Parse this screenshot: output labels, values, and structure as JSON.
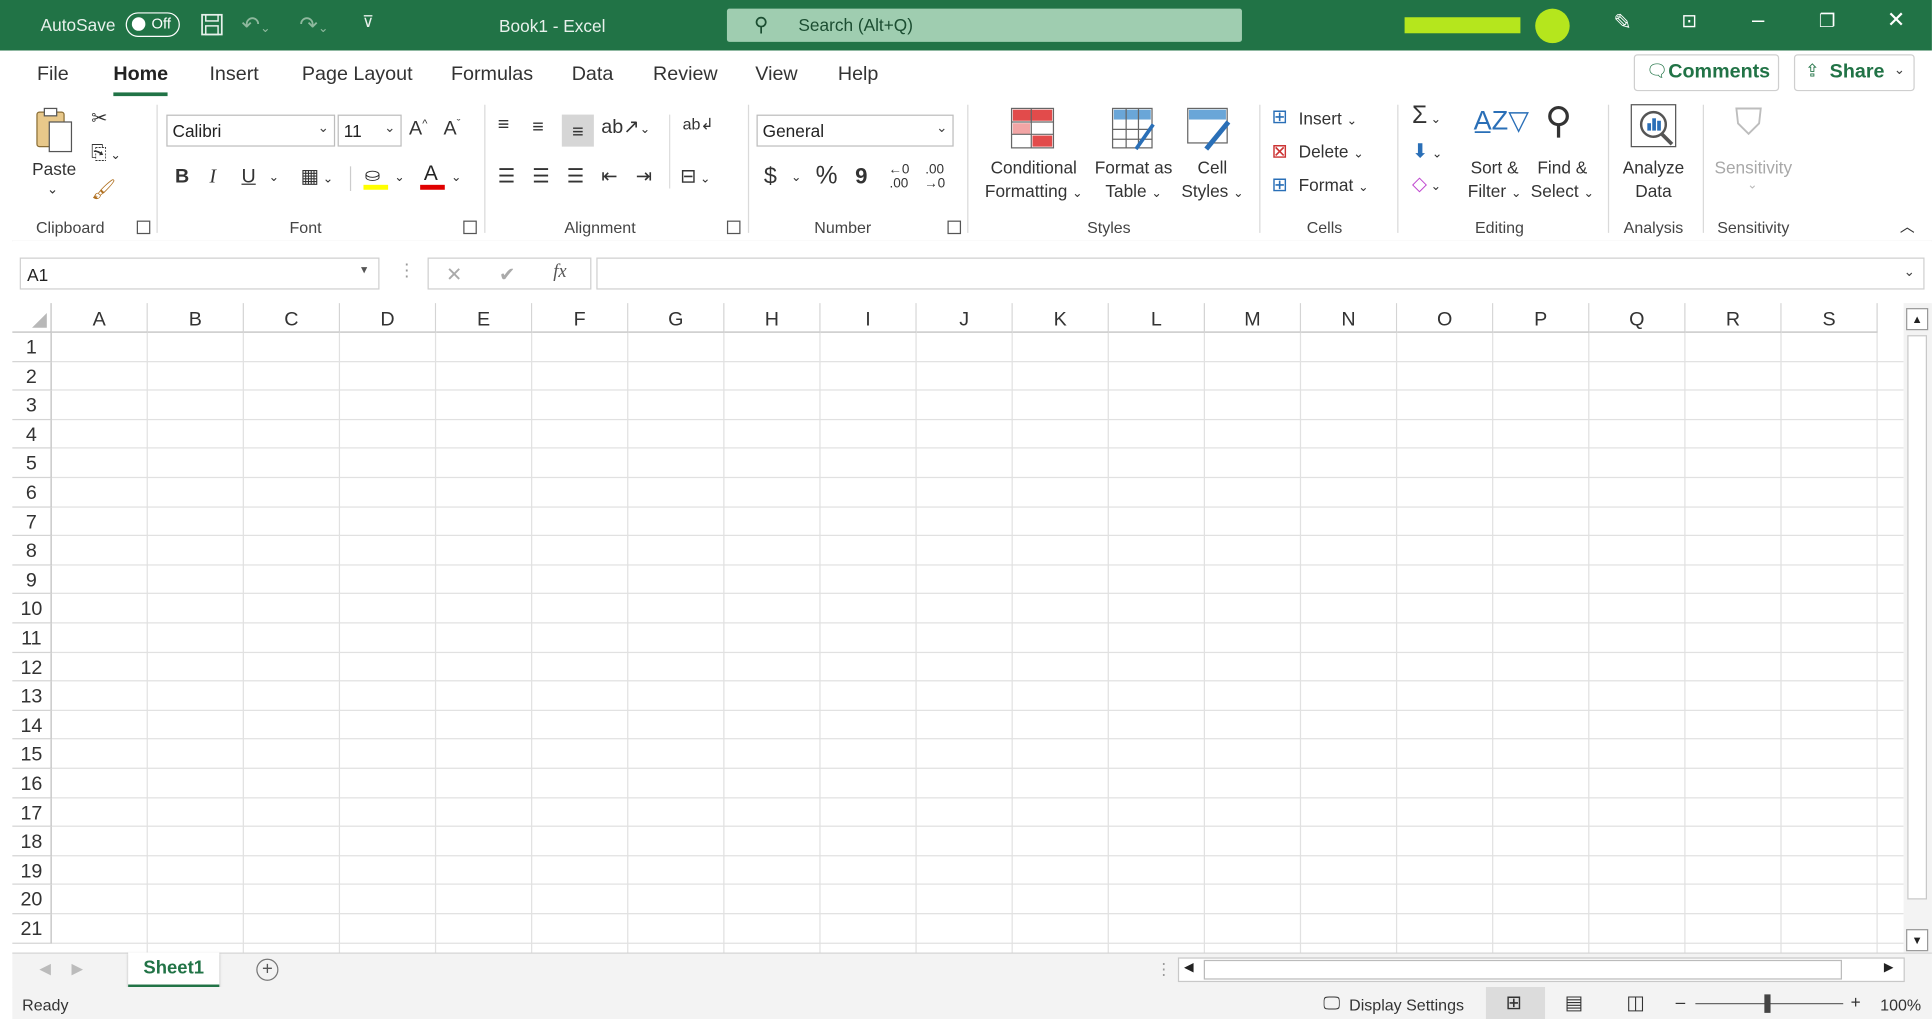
{
  "titlebar": {
    "autosave_label": "AutoSave",
    "autosave_state": "Off",
    "title": "Book1  -  Excel",
    "search_placeholder": "Search (Alt+Q)",
    "accent": "#217346"
  },
  "tabs": [
    "File",
    "Home",
    "Insert",
    "Page Layout",
    "Formulas",
    "Data",
    "Review",
    "View",
    "Help"
  ],
  "active_tab": "Home",
  "comments_label": "Comments",
  "share_label": "Share",
  "ribbon": {
    "clipboard": {
      "paste": "Paste",
      "label": "Clipboard"
    },
    "font": {
      "name": "Calibri",
      "size": "11",
      "label": "Font",
      "bold": "B",
      "italic": "I",
      "underline": "U"
    },
    "alignment": {
      "label": "Alignment"
    },
    "number": {
      "format": "General",
      "currency": "$",
      "percent": "%",
      "comma": "9",
      "label": "Number"
    },
    "styles": {
      "conditional_1": "Conditional",
      "conditional_2": "Formatting",
      "format_table_1": "Format as",
      "format_table_2": "Table",
      "cell_styles_1": "Cell",
      "cell_styles_2": "Styles",
      "label": "Styles"
    },
    "cells": {
      "insert": "Insert",
      "delete": "Delete",
      "format": "Format",
      "label": "Cells"
    },
    "editing": {
      "sort_1": "Sort &",
      "sort_2": "Filter",
      "find_1": "Find &",
      "find_2": "Select",
      "label": "Editing"
    },
    "analysis": {
      "analyze_1": "Analyze",
      "analyze_2": "Data",
      "label": "Analysis"
    },
    "sensitivity": {
      "button": "Sensitivity",
      "label": "Sensitivity"
    }
  },
  "formula_bar": {
    "name_box": "A1",
    "fx": "fx",
    "content": ""
  },
  "columns": [
    "A",
    "B",
    "C",
    "D",
    "E",
    "F",
    "G",
    "H",
    "I",
    "J",
    "K",
    "L",
    "M",
    "N",
    "O",
    "P",
    "Q",
    "R",
    "S"
  ],
  "rows": [
    "1",
    "2",
    "3",
    "4",
    "5",
    "6",
    "7",
    "8",
    "9",
    "10",
    "11",
    "12",
    "13",
    "14",
    "15",
    "16",
    "17",
    "18",
    "19",
    "20",
    "21"
  ],
  "sheet_tabs": [
    "Sheet1"
  ],
  "status": {
    "ready": "Ready",
    "display_settings": "Display Settings",
    "zoom": "100%"
  }
}
